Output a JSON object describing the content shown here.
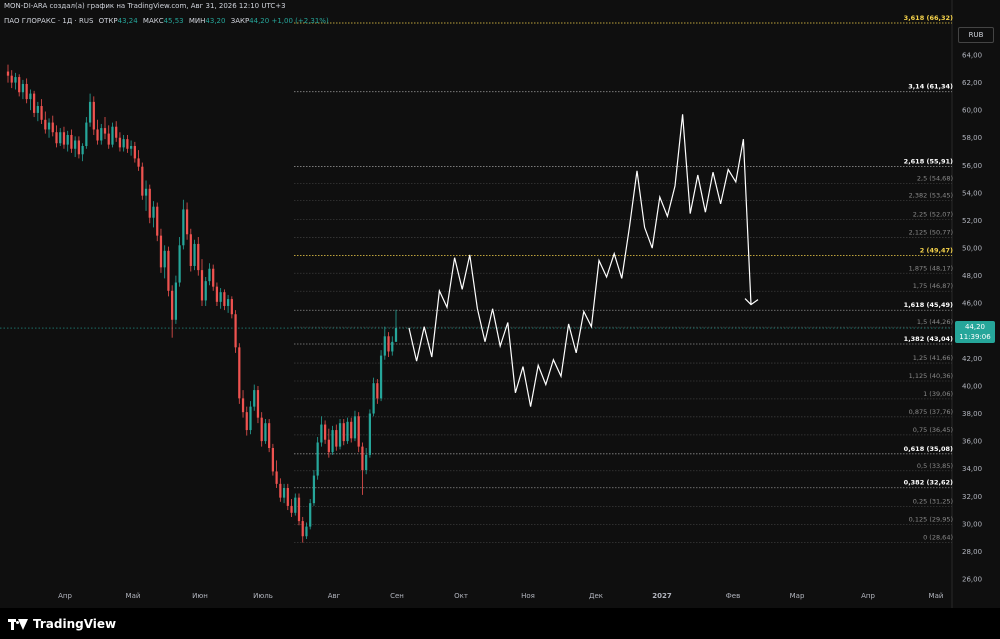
{
  "header": {
    "title": "MON-DI-ARA создал(а) график на TradingView.com, Авг 31, 2026 12:10 UTC+3"
  },
  "legend": {
    "symbol": "ПАО ГЛОРАКС · 1Д · RUS",
    "open_label": "ОТКР",
    "open": "43,24",
    "high_label": "МАКС",
    "high": "45,53",
    "low_label": "МИН",
    "low": "43,20",
    "close_label": "ЗАКР",
    "close": "44,20",
    "change": "+1,00 (+2,31%)"
  },
  "currency": "RUB",
  "last_price": {
    "value": "44,20",
    "timer": "11:39:06"
  },
  "brand": {
    "name": "TradingView"
  },
  "colors": {
    "up": "#26a69a",
    "down": "#ef5350",
    "fib_key": "#ffd54f",
    "projection": "#ffffff",
    "current_line": "#26a69a"
  },
  "chart_data": {
    "type": "candlestick",
    "y_axis": {
      "ticks": [
        "26,00",
        "28,00",
        "30,00",
        "32,00",
        "34,00",
        "36,00",
        "38,00",
        "40,00",
        "42,00",
        "44,00",
        "46,00",
        "48,00",
        "50,00",
        "52,00",
        "54,00",
        "56,00",
        "58,00",
        "60,00",
        "62,00",
        "64,00"
      ],
      "range": [
        25.2,
        66.8
      ]
    },
    "x_axis": {
      "ticks": [
        "Апр",
        "Май",
        "Июн",
        "Июль",
        "Авг",
        "Сен",
        "Окт",
        "Ноя",
        "Дек",
        "2027",
        "Фев",
        "Мар",
        "Апр",
        "Май"
      ]
    },
    "fib_levels": [
      {
        "level": 0,
        "price": 28.64,
        "label": "0 (28,64)"
      },
      {
        "level": 0.125,
        "price": 29.95,
        "label": "0,125 (29,95)"
      },
      {
        "level": 0.25,
        "price": 31.25,
        "label": "0,25 (31,25)"
      },
      {
        "level": 0.382,
        "price": 32.62,
        "label": "0,382 (32,62)",
        "key": true
      },
      {
        "level": 0.5,
        "price": 33.85,
        "label": "0,5 (33,85)"
      },
      {
        "level": 0.618,
        "price": 35.08,
        "label": "0,618 (35,08)",
        "key": true
      },
      {
        "level": 0.75,
        "price": 36.45,
        "label": "0,75 (36,45)"
      },
      {
        "level": 0.875,
        "price": 37.76,
        "label": "0,875 (37,76)"
      },
      {
        "level": 1,
        "price": 39.06,
        "label": "1 (39,06)"
      },
      {
        "level": 1.125,
        "price": 40.36,
        "label": "1,125 (40,36)"
      },
      {
        "level": 1.25,
        "price": 41.66,
        "label": "1,25 (41,66)"
      },
      {
        "level": 1.382,
        "price": 43.04,
        "label": "1,382 (43,04)",
        "key": true
      },
      {
        "level": 1.5,
        "price": 44.26,
        "label": "1,5 (44,26)"
      },
      {
        "level": 1.618,
        "price": 45.49,
        "label": "1,618 (45,49)",
        "key": true
      },
      {
        "level": 1.75,
        "price": 46.87,
        "label": "1,75 (46,87)"
      },
      {
        "level": 1.875,
        "price": 48.17,
        "label": "1,875 (48,17)"
      },
      {
        "level": 2,
        "price": 49.47,
        "label": "2 (49,47)",
        "key": true,
        "yellow": true
      },
      {
        "level": 2.125,
        "price": 50.77,
        "label": "2,125 (50,77)"
      },
      {
        "level": 2.25,
        "price": 52.07,
        "label": "2,25 (52,07)"
      },
      {
        "level": 2.382,
        "price": 53.45,
        "label": "2,382 (53,45)"
      },
      {
        "level": 2.5,
        "price": 54.68,
        "label": "2,5 (54,68)"
      },
      {
        "level": 2.618,
        "price": 55.91,
        "label": "2,618 (55,91)",
        "key": true
      },
      {
        "level": 3.14,
        "price": 61.34,
        "label": "3,14 (61,34)",
        "key": true
      },
      {
        "level": 3.618,
        "price": 66.32,
        "label": "3,618 (66,32)",
        "key": true,
        "yellow": true
      }
    ],
    "candles": [
      [
        62.8,
        63.3,
        62.0,
        62.5
      ],
      [
        62.5,
        62.9,
        61.6,
        62.0
      ],
      [
        62.0,
        62.7,
        61.5,
        62.4
      ],
      [
        62.4,
        62.6,
        61.0,
        61.3
      ],
      [
        61.3,
        62.2,
        60.8,
        61.9
      ],
      [
        61.9,
        62.3,
        60.5,
        60.8
      ],
      [
        60.8,
        61.5,
        60.0,
        61.2
      ],
      [
        61.2,
        61.4,
        59.5,
        59.8
      ],
      [
        59.8,
        60.6,
        59.2,
        60.3
      ],
      [
        60.3,
        60.8,
        59.0,
        59.3
      ],
      [
        59.3,
        59.9,
        58.3,
        58.6
      ],
      [
        58.6,
        59.4,
        58.0,
        59.1
      ],
      [
        59.1,
        59.6,
        58.1,
        58.4
      ],
      [
        58.4,
        58.9,
        57.3,
        57.6
      ],
      [
        57.6,
        58.7,
        57.4,
        58.4
      ],
      [
        58.4,
        58.8,
        57.2,
        57.5
      ],
      [
        57.5,
        58.5,
        57.0,
        58.2
      ],
      [
        58.2,
        58.6,
        56.9,
        57.2
      ],
      [
        57.2,
        58.1,
        56.6,
        57.8
      ],
      [
        57.8,
        58.1,
        56.5,
        56.8
      ],
      [
        56.8,
        57.6,
        56.3,
        57.4
      ],
      [
        57.4,
        59.5,
        57.2,
        59.1
      ],
      [
        59.1,
        61.2,
        58.8,
        60.6
      ],
      [
        60.6,
        61.0,
        58.2,
        58.6
      ],
      [
        58.6,
        59.3,
        57.5,
        57.8
      ],
      [
        57.8,
        59.0,
        57.5,
        58.7
      ],
      [
        58.7,
        59.5,
        57.9,
        58.3
      ],
      [
        58.3,
        58.9,
        57.2,
        57.5
      ],
      [
        57.5,
        59.1,
        57.3,
        58.8
      ],
      [
        58.8,
        59.2,
        57.7,
        58.0
      ],
      [
        58.0,
        58.4,
        57.0,
        57.3
      ],
      [
        57.3,
        58.2,
        57.0,
        57.9
      ],
      [
        57.9,
        58.2,
        56.9,
        57.2
      ],
      [
        57.2,
        57.8,
        56.7,
        57.4
      ],
      [
        57.4,
        57.7,
        56.2,
        56.5
      ],
      [
        56.5,
        57.1,
        55.6,
        55.9
      ],
      [
        55.9,
        56.2,
        53.5,
        53.8
      ],
      [
        53.8,
        54.9,
        52.7,
        54.3
      ],
      [
        54.3,
        54.6,
        51.8,
        52.2
      ],
      [
        52.2,
        53.4,
        51.5,
        53.0
      ],
      [
        53.0,
        53.3,
        50.5,
        50.9
      ],
      [
        50.9,
        51.4,
        48.2,
        48.6
      ],
      [
        48.6,
        50.2,
        47.8,
        49.8
      ],
      [
        49.8,
        50.1,
        46.5,
        46.9
      ],
      [
        46.9,
        47.3,
        43.5,
        44.8
      ],
      [
        44.8,
        48.0,
        44.5,
        47.5
      ],
      [
        47.5,
        50.8,
        47.2,
        50.2
      ],
      [
        50.2,
        53.5,
        49.9,
        52.8
      ],
      [
        52.8,
        53.3,
        50.6,
        51.0
      ],
      [
        51.0,
        51.4,
        48.3,
        48.7
      ],
      [
        48.7,
        50.6,
        48.4,
        50.3
      ],
      [
        50.3,
        50.8,
        48.0,
        48.4
      ],
      [
        48.4,
        49.2,
        45.8,
        46.2
      ],
      [
        46.2,
        47.9,
        45.8,
        47.6
      ],
      [
        47.6,
        48.9,
        47.3,
        48.5
      ],
      [
        48.5,
        48.8,
        46.9,
        47.2
      ],
      [
        47.2,
        47.5,
        45.8,
        46.1
      ],
      [
        46.1,
        47.1,
        45.6,
        46.8
      ],
      [
        46.8,
        47.0,
        45.5,
        45.8
      ],
      [
        45.8,
        46.6,
        45.3,
        46.3
      ],
      [
        46.3,
        46.5,
        44.9,
        45.2
      ],
      [
        45.2,
        45.5,
        42.4,
        42.8
      ],
      [
        42.8,
        43.1,
        38.7,
        39.1
      ],
      [
        39.1,
        39.7,
        37.7,
        38.1
      ],
      [
        38.1,
        38.5,
        36.4,
        36.8
      ],
      [
        36.8,
        38.9,
        36.5,
        38.5
      ],
      [
        38.5,
        40.1,
        38.2,
        39.7
      ],
      [
        39.7,
        40.0,
        37.3,
        37.7
      ],
      [
        37.7,
        38.1,
        35.6,
        36.0
      ],
      [
        36.0,
        37.6,
        35.8,
        37.3
      ],
      [
        37.3,
        37.6,
        35.2,
        35.5
      ],
      [
        35.5,
        35.8,
        33.5,
        33.8
      ],
      [
        33.8,
        34.6,
        32.6,
        32.9
      ],
      [
        32.9,
        33.3,
        31.6,
        31.9
      ],
      [
        31.9,
        32.9,
        31.5,
        32.6
      ],
      [
        32.6,
        32.9,
        31.0,
        31.3
      ],
      [
        31.3,
        31.8,
        30.5,
        30.8
      ],
      [
        30.8,
        32.2,
        30.6,
        31.9
      ],
      [
        31.9,
        32.2,
        29.9,
        30.2
      ],
      [
        30.2,
        30.5,
        28.64,
        29.1
      ],
      [
        29.1,
        30.1,
        28.9,
        29.8
      ],
      [
        29.8,
        31.8,
        29.6,
        31.5
      ],
      [
        31.5,
        33.9,
        31.3,
        33.5
      ],
      [
        33.5,
        36.3,
        33.2,
        35.9
      ],
      [
        35.9,
        37.8,
        35.6,
        37.2
      ],
      [
        37.2,
        37.5,
        35.8,
        36.1
      ],
      [
        36.1,
        36.9,
        34.8,
        35.2
      ],
      [
        35.2,
        37.1,
        35.0,
        36.8
      ],
      [
        36.8,
        37.2,
        35.3,
        35.6
      ],
      [
        35.6,
        37.6,
        35.4,
        37.3
      ],
      [
        37.3,
        37.6,
        35.7,
        36.0
      ],
      [
        36.0,
        37.7,
        35.8,
        37.4
      ],
      [
        37.4,
        37.7,
        35.9,
        36.2
      ],
      [
        36.2,
        38.2,
        36.0,
        37.8
      ],
      [
        37.8,
        38.1,
        35.2,
        35.6
      ],
      [
        35.6,
        35.9,
        32.1,
        33.9
      ],
      [
        33.9,
        35.5,
        33.6,
        35.0
      ],
      [
        35.0,
        38.3,
        34.8,
        38.0
      ],
      [
        38.0,
        40.6,
        37.8,
        40.2
      ],
      [
        40.2,
        40.5,
        38.7,
        39.1
      ],
      [
        39.1,
        42.6,
        38.9,
        42.2
      ],
      [
        42.2,
        44.3,
        41.9,
        43.6
      ],
      [
        43.6,
        43.9,
        42.1,
        42.5
      ],
      [
        42.5,
        43.6,
        42.2,
        43.2
      ],
      [
        43.2,
        45.53,
        43.2,
        44.2
      ]
    ],
    "projection": {
      "type": "line",
      "x_start": "Сен",
      "y": [
        44.2,
        41.8,
        44.3,
        42.1,
        46.9,
        45.7,
        49.3,
        47.0,
        49.5,
        45.6,
        43.2,
        45.6,
        42.9,
        44.6,
        39.5,
        41.4,
        38.5,
        41.5,
        40.1,
        41.9,
        40.7,
        44.5,
        42.4,
        45.4,
        44.3,
        49.1,
        47.9,
        49.6,
        47.8,
        51.5,
        55.6,
        51.5,
        50.0,
        53.7,
        52.3,
        54.5,
        59.7,
        52.5,
        55.3,
        52.6,
        55.5,
        53.2,
        55.7,
        54.8,
        57.9,
        45.9
      ]
    },
    "current_price": 44.2
  }
}
